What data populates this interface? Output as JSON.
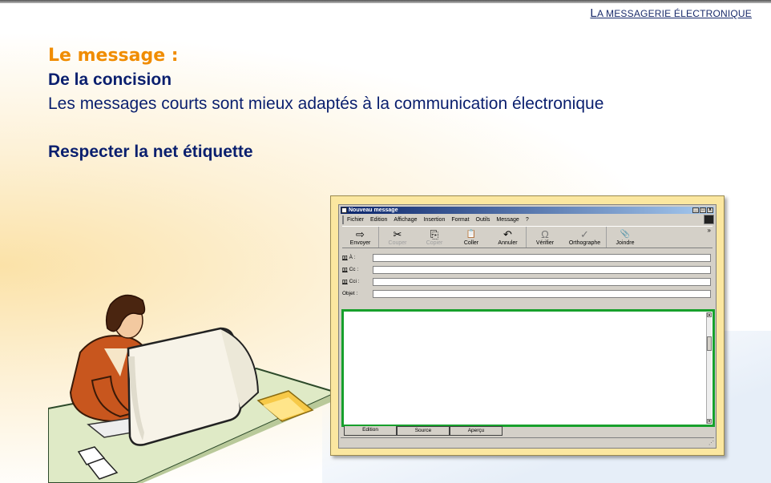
{
  "header": {
    "first_letter": "L",
    "rest": "A MESSAGERIE ÉLECTRONIQUE"
  },
  "content": {
    "title": "Le message :",
    "subtitle1": "De la concision",
    "body1": "Les messages courts sont mieux adaptés à la communication électronique",
    "subtitle2": "Respecter la net étiquette"
  },
  "window": {
    "title": "Nouveau message",
    "menu": [
      "Fichier",
      "Edition",
      "Affichage",
      "Insertion",
      "Format",
      "Outils",
      "Message",
      "?"
    ],
    "toolbar": [
      {
        "label": "Envoyer",
        "icon": "send-icon",
        "glyph": "⇨"
      },
      {
        "label": "Couper",
        "icon": "scissors-icon",
        "glyph": "✂"
      },
      {
        "label": "Copier",
        "icon": "copy-icon",
        "glyph": "⎘"
      },
      {
        "label": "Coller",
        "icon": "paste-icon",
        "glyph": "📋"
      },
      {
        "label": "Annuler",
        "icon": "undo-icon",
        "glyph": "↶"
      },
      {
        "label": "Vérifier",
        "icon": "check-names-icon",
        "glyph": "Ω"
      },
      {
        "label": "Orthographe",
        "icon": "spellcheck-icon",
        "glyph": "✓"
      },
      {
        "label": "Joindre",
        "icon": "paperclip-icon",
        "glyph": "📎"
      }
    ],
    "more": "»",
    "fields": {
      "to": "À :",
      "cc": "Cc :",
      "bcc": "Cci :",
      "subject": "Objet :"
    },
    "tabs": [
      "Edition",
      "Source",
      "Aperçu"
    ]
  },
  "colors": {
    "title_orange": "#f08c00",
    "text_navy": "#0a1f6e",
    "editor_border": "#17a02c"
  }
}
